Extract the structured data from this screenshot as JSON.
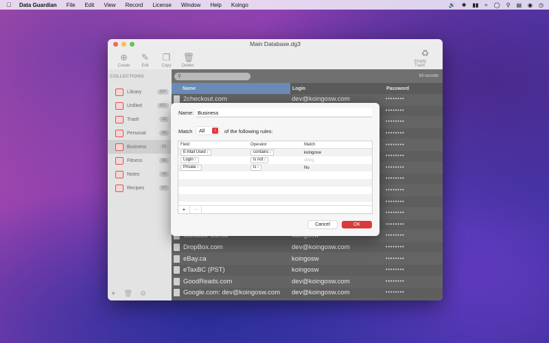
{
  "menubar": {
    "app_name": "Data Guardian",
    "items": [
      "File",
      "Edit",
      "View",
      "Record",
      "License",
      "Window",
      "Help",
      "Koingo"
    ],
    "status_icons": [
      "volume-icon",
      "bluetooth-icon",
      "battery-icon",
      "wifi-icon",
      "user-icon",
      "search-icon",
      "control-center-icon",
      "siri-icon",
      "clock-icon"
    ]
  },
  "window": {
    "title": "Main Database.dg3",
    "toolbar": [
      "Create",
      "Edit",
      "Copy",
      "Delete",
      "Empty Trash"
    ],
    "sidebar": {
      "heading": "COLLECTIONS",
      "items": [
        {
          "label": "Library",
          "count": "637"
        },
        {
          "label": "Unfiled",
          "count": "637"
        },
        {
          "label": "Trash",
          "count": "10"
        },
        {
          "label": "Personal",
          "count": "33"
        },
        {
          "label": "Business",
          "count": "63"
        },
        {
          "label": "Fitness",
          "count": "66"
        },
        {
          "label": "Notes",
          "count": "19"
        },
        {
          "label": "Recipes",
          "count": "67"
        }
      ]
    },
    "records_count": "63 records",
    "columns": {
      "name": "Name",
      "login": "Login",
      "password": "Password"
    },
    "rows": [
      {
        "name": "2checkout.com",
        "login": "dev@koingosw.com",
        "password": "••••••••"
      },
      {
        "name": "",
        "login": "",
        "password": "••••••••"
      },
      {
        "name": "",
        "login": "",
        "password": "••••••••"
      },
      {
        "name": "",
        "login": "",
        "password": "••••••••"
      },
      {
        "name": "",
        "login": "",
        "password": "••••••••"
      },
      {
        "name": "",
        "login": "",
        "password": "••••••••"
      },
      {
        "name": "",
        "login": "",
        "password": "••••••••"
      },
      {
        "name": "",
        "login": "",
        "password": "••••••••"
      },
      {
        "name": "",
        "login": "",
        "password": "••••••••"
      },
      {
        "name": "",
        "login": "",
        "password": "••••••••"
      },
      {
        "name": "",
        "login": "",
        "password": "••••••••"
      },
      {
        "name": "",
        "login": "",
        "password": "••••••••"
      },
      {
        "name": "CanadaPost.ca",
        "login": "koingosw",
        "password": "••••••••"
      },
      {
        "name": "DropBox.com",
        "login": "dev@koingosw.com",
        "password": "••••••••"
      },
      {
        "name": "eBay.ca",
        "login": "koingosw",
        "password": "••••••••"
      },
      {
        "name": "eTaxBC (PST)",
        "login": "koingosw",
        "password": "••••••••"
      },
      {
        "name": "GoodReads.com",
        "login": "dev@koingosw.com",
        "password": "••••••••"
      },
      {
        "name": "Google.com: dev@koingosw.com",
        "login": "dev@koingosw.com",
        "password": "••••••••"
      }
    ]
  },
  "dialog": {
    "name_label": "Name:",
    "name_value": "Business",
    "match_label": "Match",
    "match_value": "All",
    "match_suffix": "of the following rules:",
    "rule_columns": {
      "field": "Field",
      "operator": "Operator",
      "match": "Match"
    },
    "rules": [
      {
        "field": "E-Mail Used",
        "operator": "contains",
        "match": "koingosw",
        "placeholder": ""
      },
      {
        "field": "Login",
        "operator": "is not",
        "match": "",
        "placeholder": "string"
      },
      {
        "field": "Private",
        "operator": "is",
        "match": "No",
        "placeholder": ""
      }
    ],
    "add_label": "+",
    "remove_label": "−",
    "cancel_label": "Cancel",
    "ok_label": "OK"
  },
  "colors": {
    "accent_red": "#d93a3a",
    "selection_blue": "#6a8bb8"
  }
}
